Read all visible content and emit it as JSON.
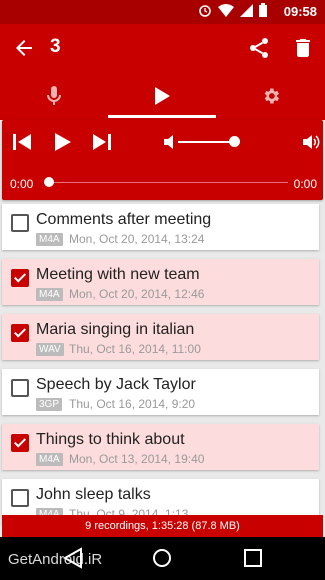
{
  "status": {
    "time": "09:58"
  },
  "toolbar": {
    "title": "3"
  },
  "player": {
    "time_start": "0:00",
    "time_end": "0:00",
    "volume": 0.9,
    "position": 0.0
  },
  "recordings": [
    {
      "name": "Comments after meeting",
      "format": "M4A",
      "date": "Mon, Oct 20, 2014, 13:24",
      "checked": false
    },
    {
      "name": "Meeting with new team",
      "format": "M4A",
      "date": "Mon, Oct 20, 2014, 12:46",
      "checked": true
    },
    {
      "name": "Maria singing in italian",
      "format": "WAV",
      "date": "Thu, Oct 16, 2014, 11:00",
      "checked": true
    },
    {
      "name": "Speech by Jack Taylor",
      "format": "3GP",
      "date": "Thu, Oct 16, 2014, 9:20",
      "checked": false
    },
    {
      "name": "Things to think about",
      "format": "M4A",
      "date": "Mon, Oct 13, 2014, 19:40",
      "checked": true
    },
    {
      "name": "John sleep talks",
      "format": "M4A",
      "date": "Thu, Oct 9, 2014, 1:13",
      "checked": false
    }
  ],
  "footer": {
    "summary": "9 recordings, 1:35:28 (87.8 MB)"
  },
  "watermark": "GetAndroid.iR",
  "colors": {
    "primary": "#c90000",
    "status_bar": "#a80000",
    "checked_row": "#fcdcdc"
  },
  "icons": [
    "alarm-icon",
    "wifi-icon",
    "signal-icon",
    "battery-icon",
    "back-arrow-icon",
    "share-icon",
    "trash-icon",
    "microphone-icon",
    "play-icon",
    "gear-icon",
    "skip-previous-icon",
    "skip-next-icon",
    "volume-low-icon",
    "volume-high-icon",
    "nav-back-icon",
    "nav-home-icon",
    "nav-recents-icon"
  ]
}
